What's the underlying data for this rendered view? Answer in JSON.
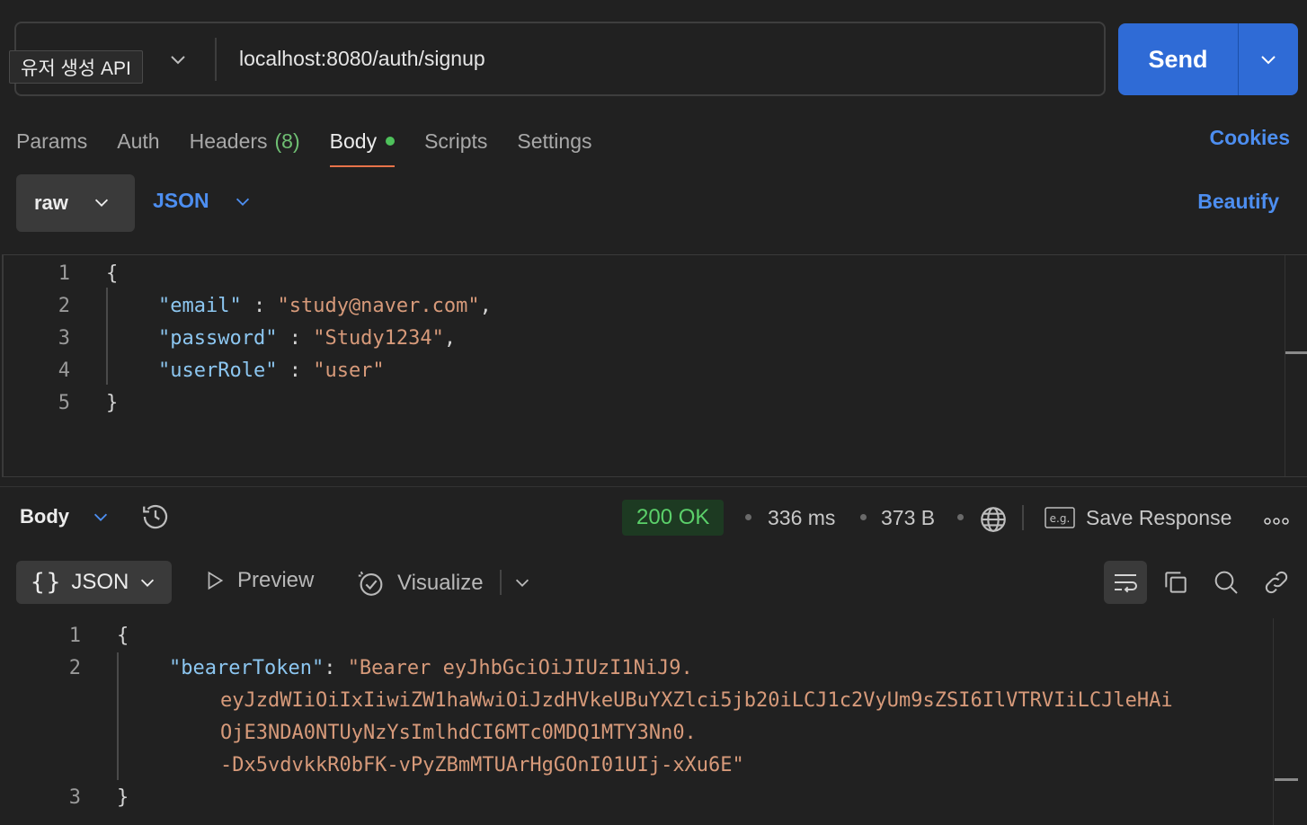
{
  "request": {
    "name": "유저 생성 API",
    "url": "localhost:8080/auth/signup",
    "send_label": "Send"
  },
  "tabs": [
    {
      "label": "Params"
    },
    {
      "label": "Auth"
    },
    {
      "label": "Headers",
      "count": "(8)"
    },
    {
      "label": "Body",
      "active": true
    },
    {
      "label": "Scripts"
    },
    {
      "label": "Settings"
    }
  ],
  "cookies_label": "Cookies",
  "body_mode": {
    "type": "raw",
    "format": "JSON",
    "beautify_label": "Beautify"
  },
  "request_body": {
    "lines": [
      {
        "n": "1",
        "text": "{"
      },
      {
        "n": "2",
        "key": "\"email\"",
        "sep": " : ",
        "val": "\"study@naver.com\"",
        "end": ","
      },
      {
        "n": "3",
        "key": "\"password\"",
        "sep": " : ",
        "val": "\"Study1234\"",
        "end": ","
      },
      {
        "n": "4",
        "key": "\"userRole\"",
        "sep": " : ",
        "val": "\"user\"",
        "end": ""
      },
      {
        "n": "5",
        "text": "}"
      }
    ]
  },
  "response": {
    "label": "Body",
    "status": "200 OK",
    "time": "336 ms",
    "size": "373 B",
    "save_label": "Save Response",
    "format": "JSON",
    "preview_label": "Preview",
    "visualize_label": "Visualize",
    "code": {
      "line1_n": "1",
      "line1": "{",
      "line2_n": "2",
      "key": "\"bearerToken\"",
      "colon": ": ",
      "val1": "\"Bearer eyJhbGciOiJIUzI1NiJ9.",
      "val2": "eyJzdWIiOiIxIiwiZW1haWwiOiJzdHVkeUBuYXZlci5jb20iLCJ1c2VyUm9sZSI6IlVTRVIiLCJleHAi",
      "val3": "OjE3NDA0NTUyNzYsImlhdCI6MTc0MDQ1MTY3Nn0.",
      "val4": "-Dx5vdvkkR0bFK-vPyZBmMTUArHgGOnI01UIj-xXu6E\"",
      "line3_n": "3",
      "line3": "}"
    }
  },
  "colors": {
    "accent": "#2f6bd6",
    "link": "#4d8ef0",
    "status_ok": "#5bd06a",
    "tab_underline": "#e8734a"
  }
}
